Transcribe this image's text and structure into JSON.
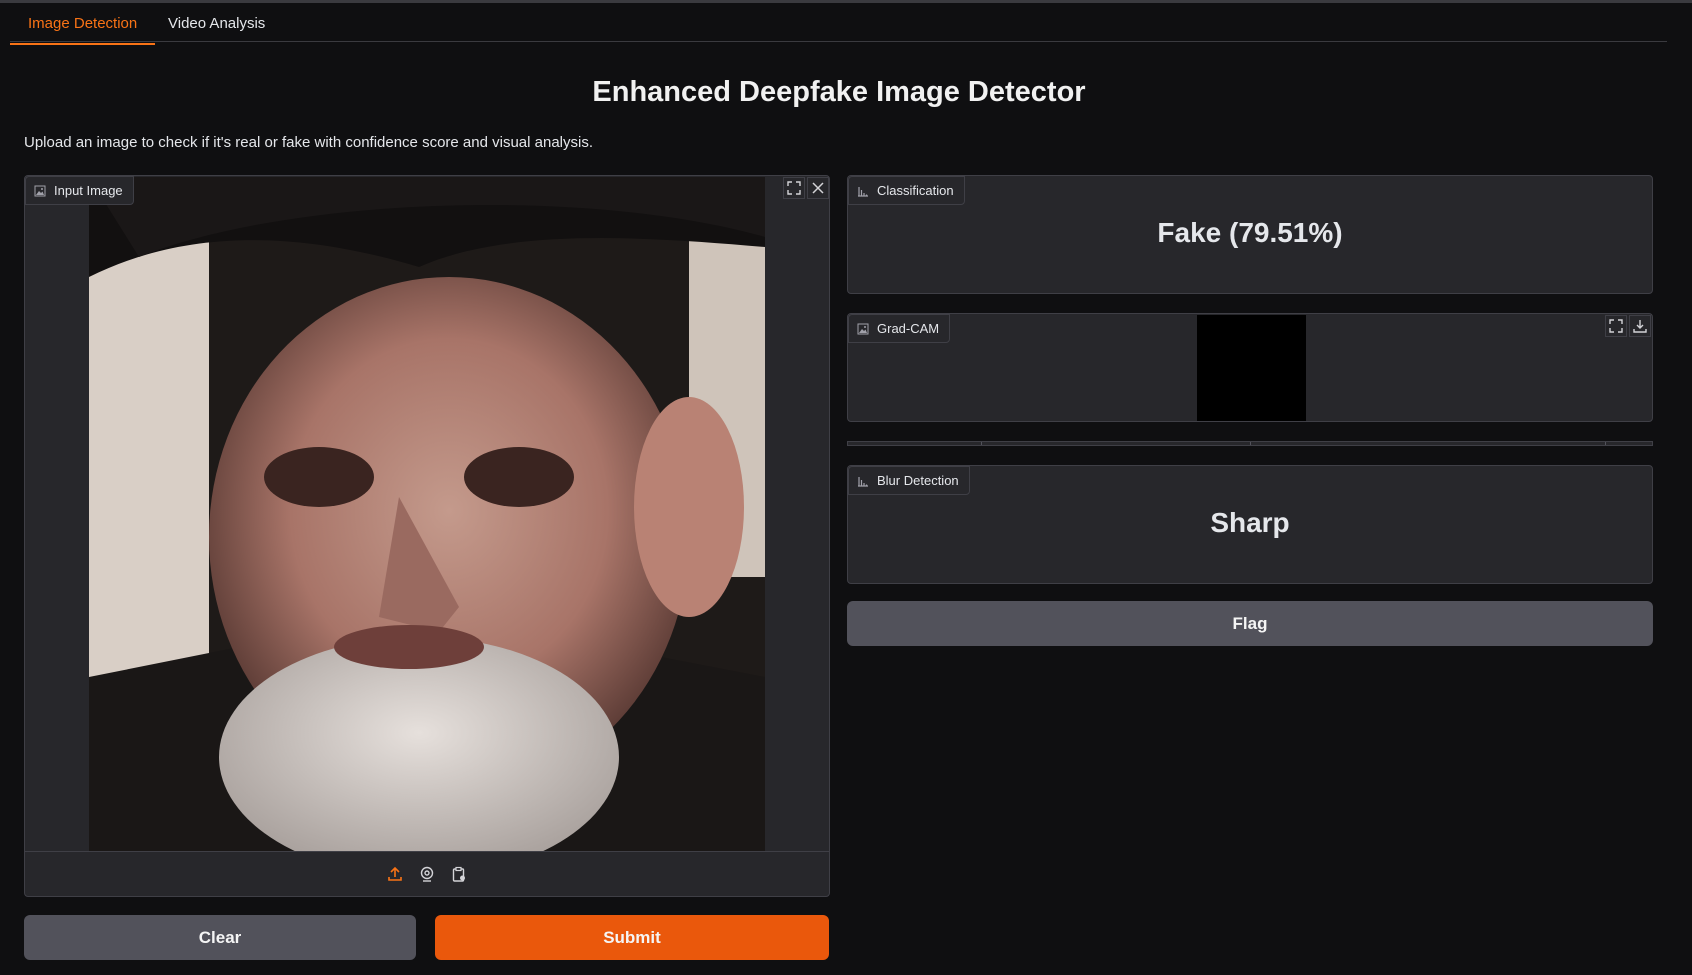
{
  "tabs": [
    {
      "label": "Image Detection",
      "active": true
    },
    {
      "label": "Video Analysis",
      "active": false
    }
  ],
  "header": {
    "title": "Enhanced Deepfake Image Detector",
    "description": "Upload an image to check if it's real or fake with confidence score and visual analysis."
  },
  "input_image": {
    "label": "Input Image",
    "icons": [
      "image-icon",
      "fullscreen-icon",
      "close-icon",
      "upload-icon",
      "webcam-icon",
      "clipboard-icon"
    ]
  },
  "classification": {
    "label": "Classification",
    "value": "Fake (79.51%)"
  },
  "gradcam": {
    "label": "Grad-CAM",
    "icons": [
      "image-icon",
      "fullscreen-icon",
      "download-icon"
    ]
  },
  "blur": {
    "label": "Blur Detection",
    "value": "Sharp"
  },
  "buttons": {
    "clear": "Clear",
    "submit": "Submit",
    "flag": "Flag"
  },
  "colors": {
    "accent": "#f97316",
    "submit": "#ea580c",
    "background": "#0f0f11",
    "panel": "#27272b",
    "secondary_button": "#52525b"
  }
}
